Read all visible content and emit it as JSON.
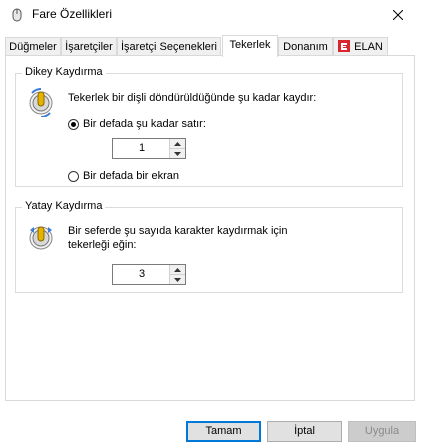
{
  "window": {
    "title": "Fare Özellikleri"
  },
  "tabs": [
    {
      "label": "Düğmeler",
      "active": false
    },
    {
      "label": "İşaretçiler",
      "active": false
    },
    {
      "label": "İşaretçi Seçenekleri",
      "active": false
    },
    {
      "label": "Tekerlek",
      "active": true
    },
    {
      "label": "Donanım",
      "active": false
    },
    {
      "label": "ELAN",
      "active": false,
      "icon": "elan-icon"
    }
  ],
  "vertical": {
    "group_label": "Dikey Kaydırma",
    "description": "Tekerlek bir dişli döndürüldüğünde şu kadar kaydır:",
    "option_lines": {
      "label": "Bir defada şu kadar satır:",
      "checked": true
    },
    "lines_value": "1",
    "option_screen": {
      "label": "Bir defada bir ekran",
      "checked": false
    }
  },
  "horizontal": {
    "group_label": "Yatay Kaydırma",
    "description": "Bir seferde şu sayıda karakter kaydırmak için tekerleği eğin:",
    "chars_value": "3"
  },
  "buttons": {
    "ok": "Tamam",
    "cancel": "İptal",
    "apply": "Uygula"
  },
  "colors": {
    "accent": "#0078d7",
    "tab_inactive": "#f0f0f0",
    "elan_red": "#d9232e"
  }
}
